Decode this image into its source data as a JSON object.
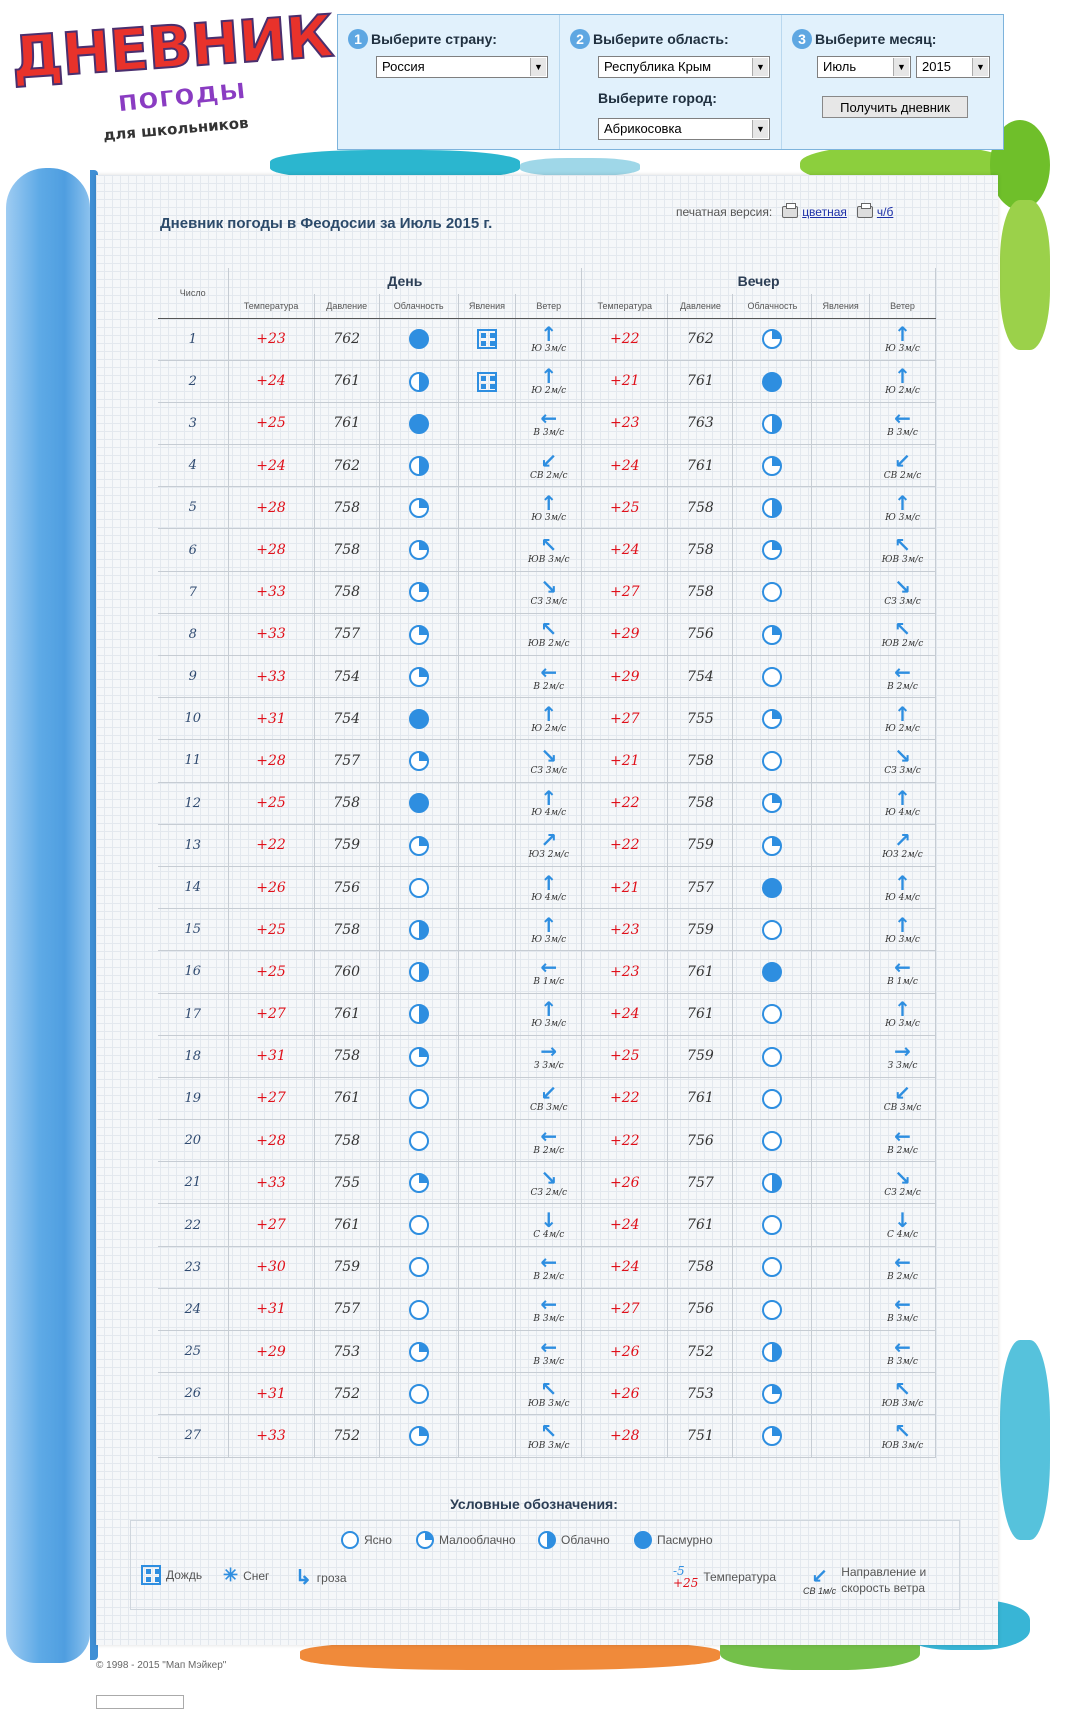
{
  "logo": {
    "line1": "ДНЕВНИК",
    "line2": "погоды",
    "line3": "для школьников"
  },
  "selector": {
    "country": {
      "num": "1",
      "label": "Выберите страну:",
      "value": "Россия"
    },
    "region": {
      "num": "2",
      "label": "Выберите область:",
      "value": "Республика Крым"
    },
    "city": {
      "label": "Выберите город:",
      "value": "Абрикосовка"
    },
    "month": {
      "num": "3",
      "label": "Выберите месяц:",
      "value": "Июль",
      "year": "2015"
    },
    "button": "Получить дневник"
  },
  "page": {
    "title": "Дневник погоды в Феодосии за Июль 2015 г.",
    "print_label": "печатная версия:",
    "print_color": "цветная",
    "print_bw": "ч/б"
  },
  "table": {
    "col_date": "Число",
    "group_day": "День",
    "group_evening": "Вечер",
    "cols": [
      "Температура",
      "Давление",
      "Облачность",
      "Явления",
      "Ветер",
      "Температура",
      "Давление",
      "Облачность",
      "Явления",
      "Ветер"
    ],
    "cloud_levels": [
      "Ясно",
      "Малооблачно",
      "Облачно",
      "Пасмурно"
    ],
    "rows": [
      {
        "d": "1",
        "dt": "+23",
        "dp": "762",
        "dc": 3,
        "dph": "rain",
        "dwa": "↑",
        "dw": "Ю 3м/с",
        "et": "+22",
        "ep": "762",
        "ec": 1,
        "ewa": "↑",
        "ew": "Ю 3м/с"
      },
      {
        "d": "2",
        "dt": "+24",
        "dp": "761",
        "dc": 2,
        "dph": "rain",
        "dwa": "↑",
        "dw": "Ю 2м/с",
        "et": "+21",
        "ep": "761",
        "ec": 3,
        "ewa": "↑",
        "ew": "Ю 2м/с"
      },
      {
        "d": "3",
        "dt": "+25",
        "dp": "761",
        "dc": 3,
        "dph": "",
        "dwa": "←",
        "dw": "В 3м/с",
        "et": "+23",
        "ep": "763",
        "ec": 2,
        "ewa": "←",
        "ew": "В 3м/с"
      },
      {
        "d": "4",
        "dt": "+24",
        "dp": "762",
        "dc": 2,
        "dph": "",
        "dwa": "↙",
        "dw": "СВ 2м/с",
        "et": "+24",
        "ep": "761",
        "ec": 1,
        "ewa": "↙",
        "ew": "СВ 2м/с"
      },
      {
        "d": "5",
        "dt": "+28",
        "dp": "758",
        "dc": 1,
        "dph": "",
        "dwa": "↑",
        "dw": "Ю 3м/с",
        "et": "+25",
        "ep": "758",
        "ec": 2,
        "ewa": "↑",
        "ew": "Ю 3м/с"
      },
      {
        "d": "6",
        "dt": "+28",
        "dp": "758",
        "dc": 1,
        "dph": "",
        "dwa": "↖",
        "dw": "ЮВ 3м/с",
        "et": "+24",
        "ep": "758",
        "ec": 1,
        "ewa": "↖",
        "ew": "ЮВ 3м/с"
      },
      {
        "d": "7",
        "dt": "+33",
        "dp": "758",
        "dc": 1,
        "dph": "",
        "dwa": "↘",
        "dw": "СЗ 3м/с",
        "et": "+27",
        "ep": "758",
        "ec": 0,
        "ewa": "↘",
        "ew": "СЗ 3м/с"
      },
      {
        "d": "8",
        "dt": "+33",
        "dp": "757",
        "dc": 1,
        "dph": "",
        "dwa": "↖",
        "dw": "ЮВ 2м/с",
        "et": "+29",
        "ep": "756",
        "ec": 1,
        "ewa": "↖",
        "ew": "ЮВ 2м/с"
      },
      {
        "d": "9",
        "dt": "+33",
        "dp": "754",
        "dc": 1,
        "dph": "",
        "dwa": "←",
        "dw": "В 2м/с",
        "et": "+29",
        "ep": "754",
        "ec": 0,
        "ewa": "←",
        "ew": "В 2м/с"
      },
      {
        "d": "10",
        "dt": "+31",
        "dp": "754",
        "dc": 3,
        "dph": "",
        "dwa": "↑",
        "dw": "Ю 2м/с",
        "et": "+27",
        "ep": "755",
        "ec": 1,
        "ewa": "↑",
        "ew": "Ю 2м/с"
      },
      {
        "d": "11",
        "dt": "+28",
        "dp": "757",
        "dc": 1,
        "dph": "",
        "dwa": "↘",
        "dw": "СЗ 3м/с",
        "et": "+21",
        "ep": "758",
        "ec": 0,
        "ewa": "↘",
        "ew": "СЗ 3м/с"
      },
      {
        "d": "12",
        "dt": "+25",
        "dp": "758",
        "dc": 3,
        "dph": "",
        "dwa": "↑",
        "dw": "Ю 4м/с",
        "et": "+22",
        "ep": "758",
        "ec": 1,
        "ewa": "↑",
        "ew": "Ю 4м/с"
      },
      {
        "d": "13",
        "dt": "+22",
        "dp": "759",
        "dc": 1,
        "dph": "",
        "dwa": "↗",
        "dw": "ЮЗ 2м/с",
        "et": "+22",
        "ep": "759",
        "ec": 1,
        "ewa": "↗",
        "ew": "ЮЗ 2м/с"
      },
      {
        "d": "14",
        "dt": "+26",
        "dp": "756",
        "dc": 0,
        "dph": "",
        "dwa": "↑",
        "dw": "Ю 4м/с",
        "et": "+21",
        "ep": "757",
        "ec": 3,
        "ewa": "↑",
        "ew": "Ю 4м/с"
      },
      {
        "d": "15",
        "dt": "+25",
        "dp": "758",
        "dc": 2,
        "dph": "",
        "dwa": "↑",
        "dw": "Ю 3м/с",
        "et": "+23",
        "ep": "759",
        "ec": 0,
        "ewa": "↑",
        "ew": "Ю 3м/с"
      },
      {
        "d": "16",
        "dt": "+25",
        "dp": "760",
        "dc": 2,
        "dph": "",
        "dwa": "←",
        "dw": "В 1м/с",
        "et": "+23",
        "ep": "761",
        "ec": 3,
        "ewa": "←",
        "ew": "В 1м/с"
      },
      {
        "d": "17",
        "dt": "+27",
        "dp": "761",
        "dc": 2,
        "dph": "",
        "dwa": "↑",
        "dw": "Ю 3м/с",
        "et": "+24",
        "ep": "761",
        "ec": 0,
        "ewa": "↑",
        "ew": "Ю 3м/с"
      },
      {
        "d": "18",
        "dt": "+31",
        "dp": "758",
        "dc": 1,
        "dph": "",
        "dwa": "→",
        "dw": "З 3м/с",
        "et": "+25",
        "ep": "759",
        "ec": 0,
        "ewa": "→",
        "ew": "З 3м/с"
      },
      {
        "d": "19",
        "dt": "+27",
        "dp": "761",
        "dc": 0,
        "dph": "",
        "dwa": "↙",
        "dw": "СВ 3м/с",
        "et": "+22",
        "ep": "761",
        "ec": 0,
        "ewa": "↙",
        "ew": "СВ 3м/с"
      },
      {
        "d": "20",
        "dt": "+28",
        "dp": "758",
        "dc": 0,
        "dph": "",
        "dwa": "←",
        "dw": "В 2м/с",
        "et": "+22",
        "ep": "756",
        "ec": 0,
        "ewa": "←",
        "ew": "В 2м/с"
      },
      {
        "d": "21",
        "dt": "+33",
        "dp": "755",
        "dc": 1,
        "dph": "",
        "dwa": "↘",
        "dw": "СЗ 2м/с",
        "et": "+26",
        "ep": "757",
        "ec": 2,
        "ewa": "↘",
        "ew": "СЗ 2м/с"
      },
      {
        "d": "22",
        "dt": "+27",
        "dp": "761",
        "dc": 0,
        "dph": "",
        "dwa": "↓",
        "dw": "С 4м/с",
        "et": "+24",
        "ep": "761",
        "ec": 0,
        "ewa": "↓",
        "ew": "С 4м/с"
      },
      {
        "d": "23",
        "dt": "+30",
        "dp": "759",
        "dc": 0,
        "dph": "",
        "dwa": "←",
        "dw": "В 2м/с",
        "et": "+24",
        "ep": "758",
        "ec": 0,
        "ewa": "←",
        "ew": "В 2м/с"
      },
      {
        "d": "24",
        "dt": "+31",
        "dp": "757",
        "dc": 0,
        "dph": "",
        "dwa": "←",
        "dw": "В 3м/с",
        "et": "+27",
        "ep": "756",
        "ec": 0,
        "ewa": "←",
        "ew": "В 3м/с"
      },
      {
        "d": "25",
        "dt": "+29",
        "dp": "753",
        "dc": 1,
        "dph": "",
        "dwa": "←",
        "dw": "В 3м/с",
        "et": "+26",
        "ep": "752",
        "ec": 2,
        "ewa": "←",
        "ew": "В 3м/с"
      },
      {
        "d": "26",
        "dt": "+31",
        "dp": "752",
        "dc": 0,
        "dph": "",
        "dwa": "↖",
        "dw": "ЮВ 3м/с",
        "et": "+26",
        "ep": "753",
        "ec": 1,
        "ewa": "↖",
        "ew": "ЮВ 3м/с"
      },
      {
        "d": "27",
        "dt": "+33",
        "dp": "752",
        "dc": 1,
        "dph": "",
        "dwa": "↖",
        "dw": "ЮВ 3м/с",
        "et": "+28",
        "ep": "751",
        "ec": 1,
        "ewa": "↖",
        "ew": "ЮВ 3м/с"
      }
    ]
  },
  "legend": {
    "title": "Условные обозначения:",
    "clear": "Ясно",
    "few": "Малооблачно",
    "cloudy": "Облачно",
    "overcast": "Пасмурно",
    "rain": "Дождь",
    "snow": "Снег",
    "storm": "гроза",
    "temp_sample_neg": "-5",
    "temp_sample_pos": "+25",
    "temp_label": "Температура",
    "wind_sample": "СВ 1м/с",
    "wind_label_1": "Направление и",
    "wind_label_2": "скорость ветра"
  },
  "footer": {
    "copyright": "© 1998 - 2015 \"Мап Мэйкер\""
  },
  "colors": {
    "accent": "#2e8ee0",
    "temperature": "#e0101a",
    "roll": "#5eaae6",
    "panel": "#e1f1fc"
  }
}
